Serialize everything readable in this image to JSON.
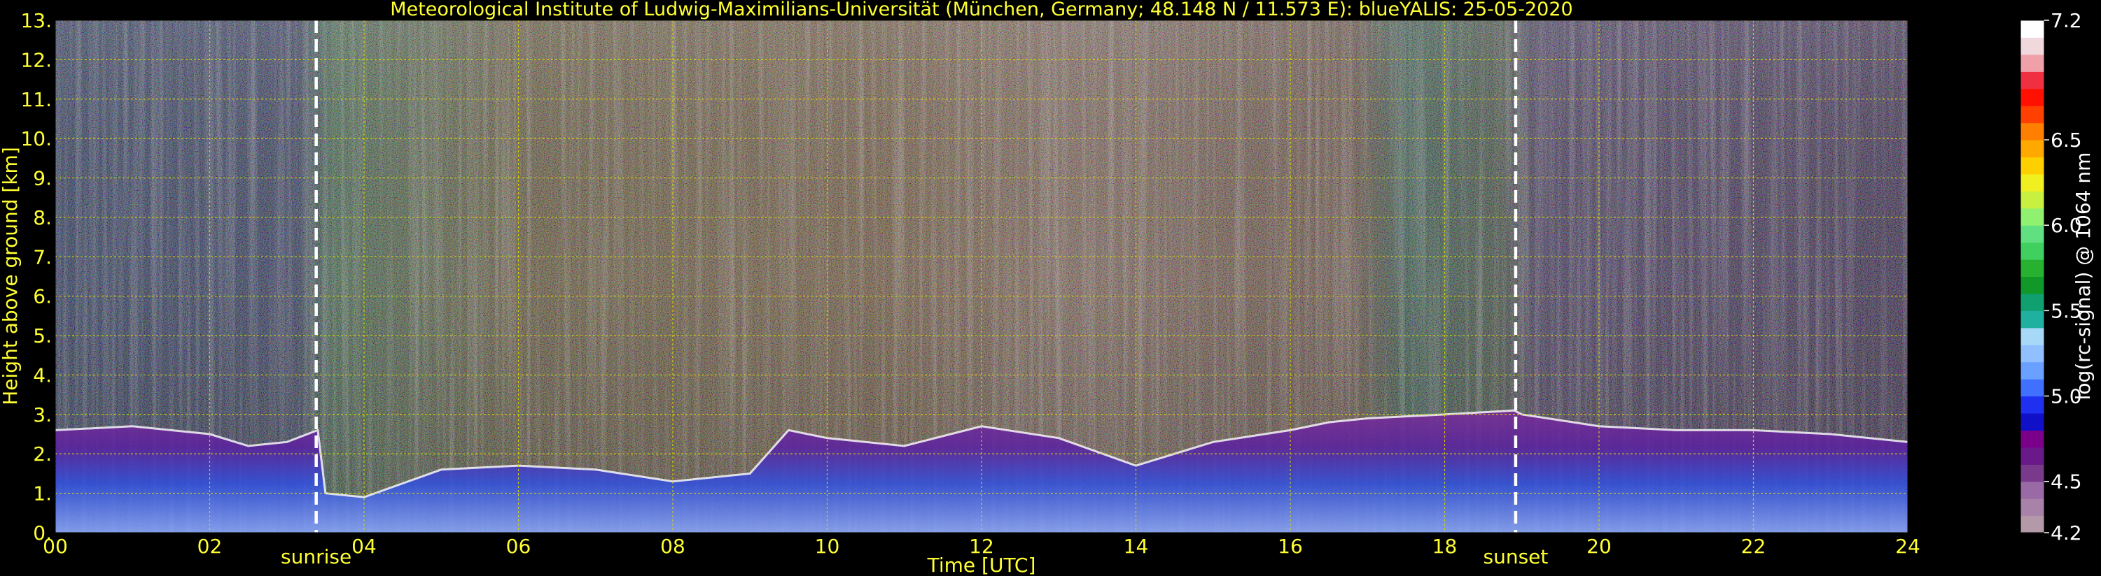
{
  "chart_data": {
    "type": "heatmap",
    "title": "Meteorological Institute of Ludwig-Maximilians-Universität (München, Germany; 48.148 N / 11.573 E):    blueYALIS: 25-05-2020",
    "xlabel": "Time [UTC]",
    "ylabel": "Height above ground [km]",
    "xlim": [
      0,
      24
    ],
    "ylim": [
      0,
      13
    ],
    "x_ticks": [
      "00",
      "02",
      "04",
      "06",
      "08",
      "10",
      "12",
      "14",
      "16",
      "18",
      "20",
      "22",
      "24"
    ],
    "y_ticks": [
      "0.",
      "1.",
      "2.",
      "3.",
      "4.",
      "5.",
      "6.",
      "7.",
      "8.",
      "9.",
      "10.",
      "11.",
      "12.",
      "13."
    ],
    "grid": true,
    "colorbar": {
      "label": "log(rc-signal) @ 1064 nm",
      "range": [
        4.2,
        7.2
      ],
      "tick_labels": [
        "4.2",
        "4.5",
        "5.0",
        "5.5",
        "6.0",
        "6.5",
        "7.2"
      ],
      "tick_values": [
        4.2,
        4.5,
        5.0,
        5.5,
        6.0,
        6.5,
        7.2
      ],
      "colors": [
        "#b49aa8",
        "#a882a8",
        "#9a6aa6",
        "#7a3a8c",
        "#6a1a88",
        "#7a008a",
        "#1010c8",
        "#2030f0",
        "#4070ff",
        "#6aa0ff",
        "#90c0ff",
        "#a8d8f8",
        "#20b0a0",
        "#10a070",
        "#109828",
        "#28b030",
        "#40d060",
        "#60e080",
        "#90f070",
        "#c8f040",
        "#f0f020",
        "#ffd000",
        "#ffa800",
        "#ff8000",
        "#ff4000",
        "#ff1000",
        "#f03040",
        "#f0a0a8",
        "#f0d8dc",
        "#ffffff"
      ]
    },
    "events": [
      {
        "label": "sunrise",
        "time_utc": 3.38
      },
      {
        "label": "sunset",
        "time_utc": 18.92
      }
    ],
    "aerosol_layer_top_km": {
      "x": [
        0,
        1,
        2,
        2.5,
        3,
        3.4,
        3.5,
        4,
        5,
        6,
        7,
        8,
        9,
        9.5,
        10,
        11,
        12,
        13,
        14,
        15,
        16,
        16.5,
        17,
        18,
        18.9,
        19,
        20,
        21,
        22,
        23,
        24
      ],
      "y": [
        2.6,
        2.7,
        2.5,
        2.2,
        2.3,
        2.6,
        1.0,
        0.9,
        1.6,
        1.7,
        1.6,
        1.3,
        1.5,
        2.6,
        2.4,
        2.2,
        2.7,
        2.4,
        1.7,
        2.3,
        2.6,
        2.8,
        2.9,
        3.0,
        3.1,
        3.0,
        2.7,
        2.6,
        2.6,
        2.5,
        2.3
      ]
    }
  }
}
